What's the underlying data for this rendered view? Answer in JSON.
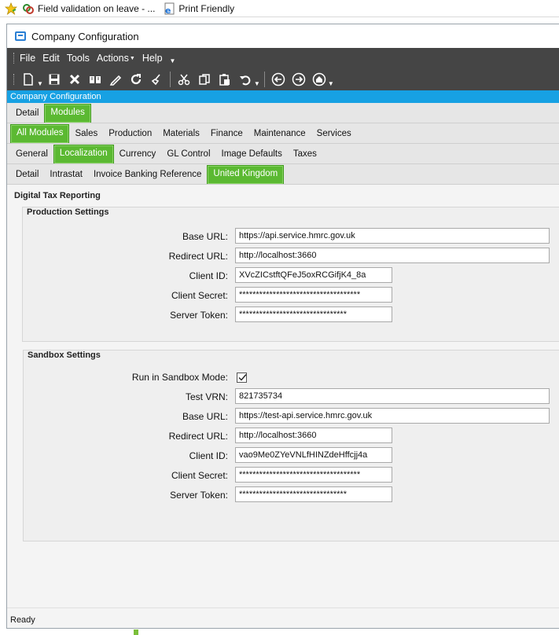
{
  "favorites_bar": {
    "items": [
      {
        "label": "Field validation on leave - ...",
        "icon": "link-icon"
      },
      {
        "label": "Print Friendly",
        "icon": "ie-page-icon"
      }
    ]
  },
  "window": {
    "title": "Company Configuration"
  },
  "menu": {
    "items": [
      "File",
      "Edit",
      "Tools",
      "Actions",
      "Help"
    ]
  },
  "toolbar": {
    "icons": [
      "new-icon",
      "save-icon",
      "delete-icon",
      "book-icon",
      "edit-icon",
      "refresh-icon",
      "clear-icon",
      "cut-icon",
      "copy-icon",
      "paste-icon",
      "undo-icon",
      "back-icon",
      "forward-icon",
      "home-icon"
    ]
  },
  "module_banner": "Company Configuration",
  "tabs_level1": {
    "items": [
      "Detail",
      "Modules"
    ],
    "active": "Modules"
  },
  "tabs_level2": {
    "items": [
      "All Modules",
      "Sales",
      "Production",
      "Materials",
      "Finance",
      "Maintenance",
      "Services"
    ],
    "active": "All Modules"
  },
  "tabs_level3": {
    "items": [
      "General",
      "Localization",
      "Currency",
      "GL Control",
      "Image Defaults",
      "Taxes"
    ],
    "active": "Localization"
  },
  "tabs_level4": {
    "items": [
      "Detail",
      "Intrastat",
      "Invoice Banking Reference",
      "United Kingdom"
    ],
    "active": "United Kingdom"
  },
  "section_title": "Digital Tax Reporting",
  "production": {
    "title": "Production Settings",
    "base_url_label": "Base URL:",
    "base_url": "https://api.service.hmrc.gov.uk",
    "redirect_url_label": "Redirect URL:",
    "redirect_url": "http://localhost:3660",
    "client_id_label": "Client ID:",
    "client_id": "XVcZICstftQFeJ5oxRCGifjK4_8a",
    "client_secret_label": "Client Secret:",
    "client_secret": "************************************",
    "server_token_label": "Server Token:",
    "server_token": "********************************"
  },
  "sandbox": {
    "title": "Sandbox Settings",
    "run_label": "Run in Sandbox Mode:",
    "run_checked": true,
    "vrn_label": "Test VRN:",
    "vrn": "821735734",
    "base_url_label": "Base URL:",
    "base_url": "https://test-api.service.hmrc.gov.uk",
    "redirect_url_label": "Redirect URL:",
    "redirect_url": "http://localhost:3660",
    "client_id_label": "Client ID:",
    "client_id": "vao9Me0ZYeVNLfHINZdeHffcjj4a",
    "client_secret_label": "Client Secret:",
    "client_secret": "************************************",
    "server_token_label": "Server Token:",
    "server_token": "********************************"
  },
  "status": "Ready",
  "colors": {
    "accent_green": "#5bb932",
    "banner_blue": "#17a1e3",
    "menu_dark": "#454545"
  }
}
